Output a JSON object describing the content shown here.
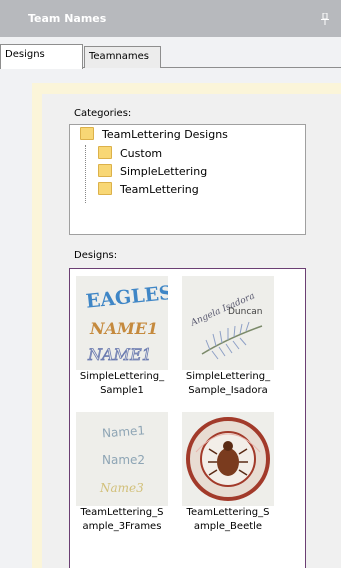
{
  "window": {
    "title": "Team Names",
    "pin_icon": "pin-icon"
  },
  "tabs": [
    {
      "label": "Designs",
      "active": true
    },
    {
      "label": "Teamnames",
      "active": false
    }
  ],
  "categories": {
    "label": "Categories:",
    "root": "TeamLettering Designs",
    "children": [
      "Custom",
      "SimpleLettering",
      "TeamLettering"
    ]
  },
  "designs": {
    "label": "Designs:",
    "items": [
      {
        "caption_line1": "SimpleLettering_",
        "caption_line2": "Sample1"
      },
      {
        "caption_line1": "SimpleLettering_",
        "caption_line2": "Sample_Isadora"
      },
      {
        "caption_line1": "TeamLettering_S",
        "caption_line2": "ample_3Frames"
      },
      {
        "caption_line1": "TeamLettering_S",
        "caption_line2": "ample_Beetle"
      }
    ]
  },
  "colors": {
    "title_bar": "#b7b9bd",
    "folder": "#f8d775",
    "designs_border": "#6b3f73"
  }
}
